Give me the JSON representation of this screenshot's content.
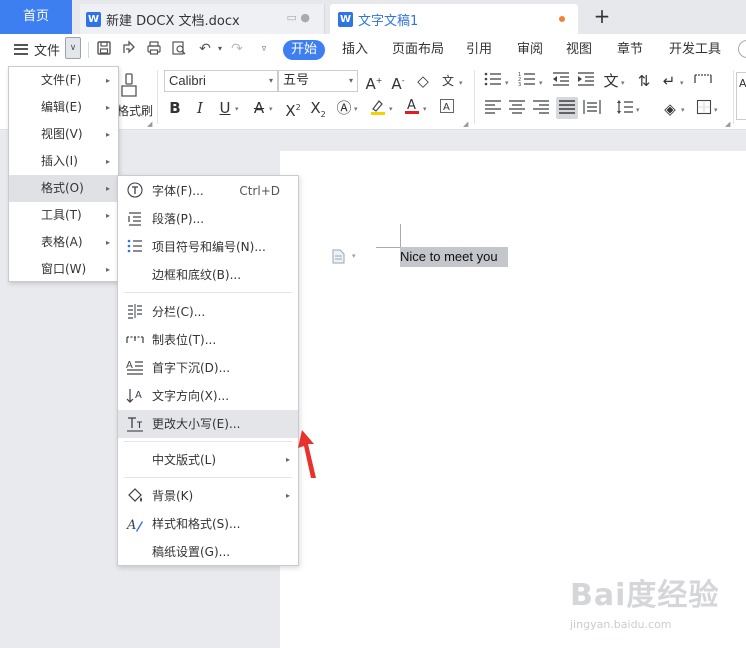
{
  "tabs": {
    "home": "首页",
    "doc1": "新建 DOCX 文档.docx",
    "doc2": "文字文稿1",
    "new_tab": "+"
  },
  "toolbar": {
    "file_menu": "文件",
    "ribbon_tabs": [
      "开始",
      "插入",
      "页面布局",
      "引用",
      "审阅",
      "视图",
      "章节",
      "开发工具"
    ]
  },
  "ribbon": {
    "font": "Calibri",
    "size": "五号",
    "format_painter": "格式刷"
  },
  "menu_main": [
    {
      "label": "文件(F)"
    },
    {
      "label": "编辑(E)"
    },
    {
      "label": "视图(V)"
    },
    {
      "label": "插入(I)"
    },
    {
      "label": "格式(O)"
    },
    {
      "label": "工具(T)"
    },
    {
      "label": "表格(A)"
    },
    {
      "label": "窗口(W)"
    }
  ],
  "menu_format": [
    {
      "label": "字体(F)...",
      "shortcut": "Ctrl+D",
      "icon": "font-icon"
    },
    {
      "label": "段落(P)...",
      "icon": "paragraph-icon"
    },
    {
      "label": "项目符号和编号(N)...",
      "icon": "bullet-list-icon"
    },
    {
      "label": "边框和底纹(B)..."
    },
    {
      "label": "分栏(C)...",
      "icon": "columns-icon"
    },
    {
      "label": "制表位(T)...",
      "icon": "tab-stop-icon"
    },
    {
      "label": "首字下沉(D)...",
      "icon": "drop-cap-icon"
    },
    {
      "label": "文字方向(X)...",
      "icon": "text-direction-icon"
    },
    {
      "label": "更改大小写(E)...",
      "icon": "change-case-icon"
    },
    {
      "label": "中文版式(L)"
    },
    {
      "label": "背景(K)",
      "icon": "background-fill-icon"
    },
    {
      "label": "样式和格式(S)...",
      "icon": "styles-icon"
    },
    {
      "label": "稿纸设置(G)..."
    }
  ],
  "document": {
    "selected_text": "Nice to meet you"
  },
  "watermark": {
    "brand": "Bai度经验",
    "url": "jingyan.baidu.com"
  },
  "colors": {
    "accent": "#3d7ff0",
    "highlight": "#dfe1e4",
    "annotation_arrow": "#e8322b"
  }
}
